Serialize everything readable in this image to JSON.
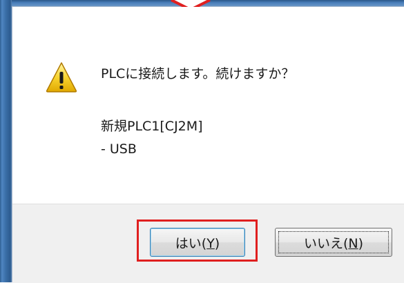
{
  "dialog": {
    "message": "PLCに接続します。続けますか？",
    "target_device": "新規PLC1[CJ2M]",
    "connection": "- USB",
    "icon": "warning-icon"
  },
  "buttons": {
    "yes_text": "はい(",
    "yes_key": "Y",
    "yes_close": ")",
    "no_text": "いいえ(",
    "no_key": "N",
    "no_close": ")"
  },
  "colors": {
    "highlight": "#e01f1f",
    "frame": "#3b6fa8",
    "button_bar": "#f0f0f0"
  }
}
